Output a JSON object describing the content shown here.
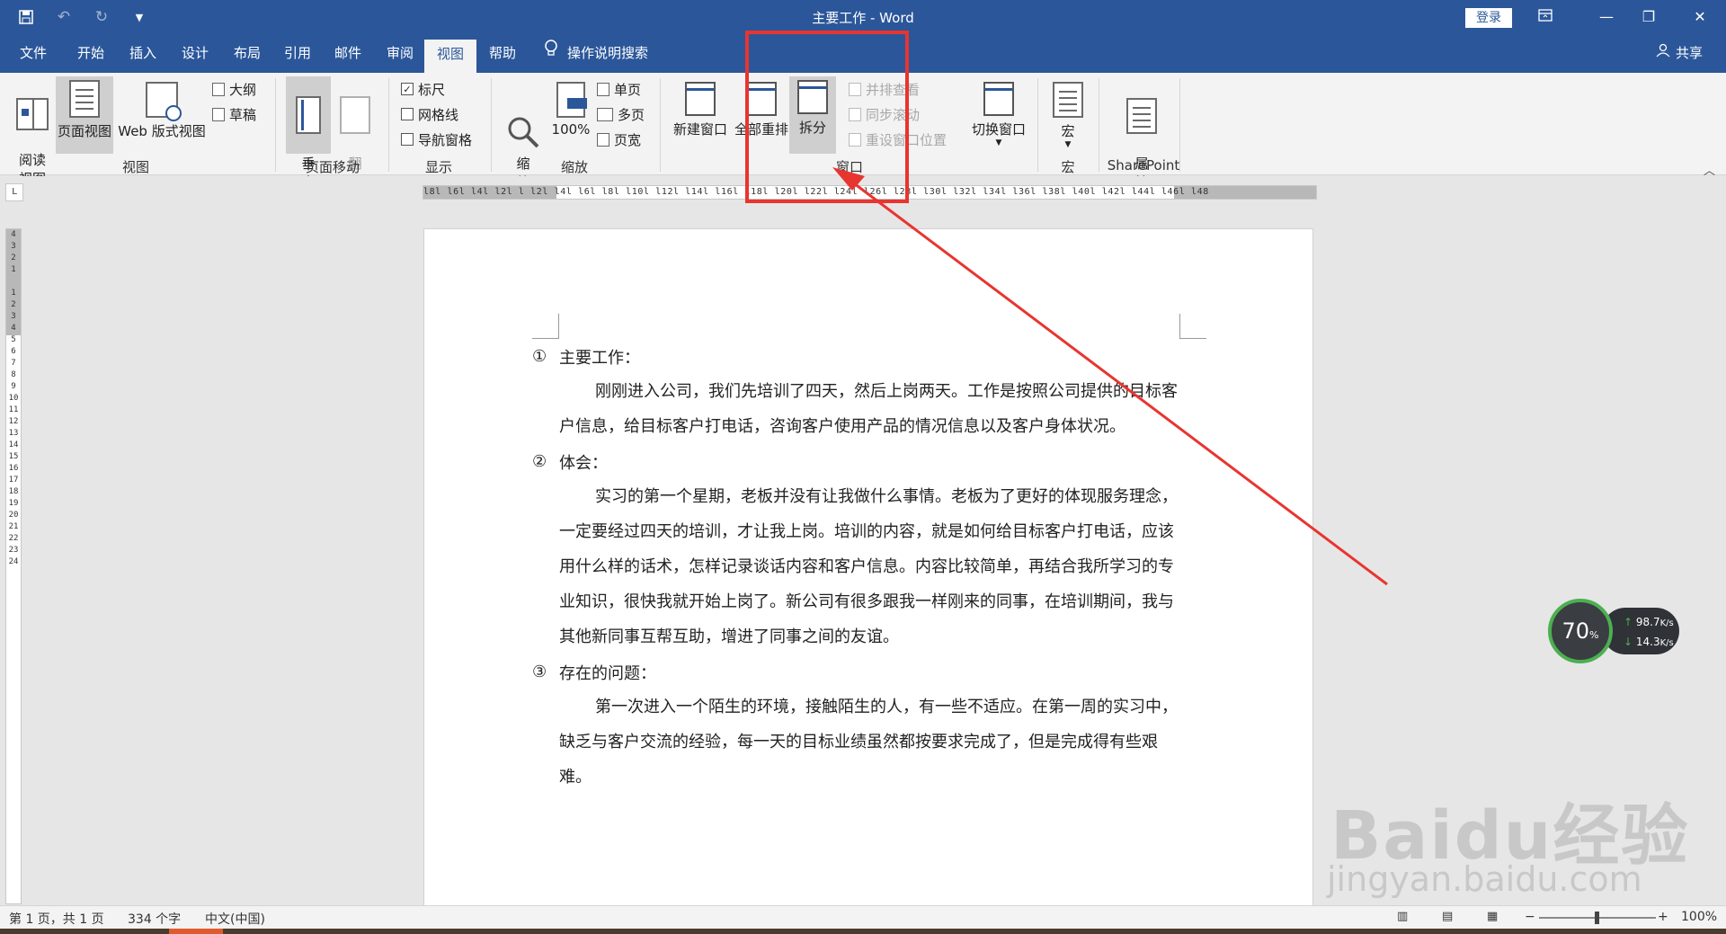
{
  "titlebar": {
    "title": "主要工作  -  Word",
    "login_label": "登录",
    "qat": {
      "save_icon": "save-icon",
      "undo_icon": "undo-icon",
      "redo_icon": "redo-icon",
      "customize_icon": "customize-icon"
    }
  },
  "tabs": [
    "文件",
    "开始",
    "插入",
    "设计",
    "布局",
    "引用",
    "邮件",
    "审阅",
    "视图",
    "帮助"
  ],
  "active_tab": "视图",
  "tell_me": "操作说明搜索",
  "share": "共享",
  "ribbon": {
    "views": {
      "read": "阅读\n视图",
      "print": "页面视图",
      "web": "Web 版式视图",
      "outline": "大纲",
      "draft": "草稿",
      "label": "视图"
    },
    "page_move": {
      "vertical": "垂\n直",
      "side": "翻\n页",
      "label": "页面移动"
    },
    "show": {
      "ruler": "标尺",
      "gridlines": "网格线",
      "nav_pane": "导航窗格",
      "label": "显示",
      "ruler_checked": true
    },
    "zoom": {
      "zoom": "缩\n放",
      "hundred": "100%",
      "one_page": "单页",
      "multi_page": "多页",
      "page_width": "页宽",
      "label": "缩放"
    },
    "window": {
      "new_window": "新建窗口",
      "arrange_all": "全部重排",
      "split": "拆分",
      "side_by_side": "并排查看",
      "sync_scroll": "同步滚动",
      "reset_pos": "重设窗口位置",
      "switch": "切换窗口",
      "label": "窗口"
    },
    "macros": {
      "macros": "宏",
      "label": "宏"
    },
    "sharepoint": {
      "properties": "属\n性",
      "label": "SharePoint"
    }
  },
  "ruler": {
    "h_numbers": "l8l l6l l4l l2l l   l2l l4l l6l l8l l10l l12l l14l l16l l18l l20l l22l l24l l26l l28l l30l l32l l34l l36l l38l l40l l42l l44l l46l l48",
    "v_numbers": "4\n3\n2\n1\n\n1\n2\n3\n4\n5\n6\n7\n8\n9\n10\n11\n12\n13\n14\n15\n16\n17\n18\n19\n20\n21\n22\n23\n24"
  },
  "document": {
    "sections": [
      {
        "num": "①",
        "heading": "主要工作：",
        "body": "刚刚进入公司，我们先培训了四天，然后上岗两天。工作是按照公司提供的目标客户信息，给目标客户打电话，咨询客户使用产品的情况信息以及客户身体状况。"
      },
      {
        "num": "②",
        "heading": "体会：",
        "body": "实习的第一个星期，老板并没有让我做什么事情。老板为了更好的体现服务理念，一定要经过四天的培训，才让我上岗。培训的内容，就是如何给目标客户打电话，应该用什么样的话术，怎样记录谈话内容和客户信息。内容比较简单，再结合我所学习的专业知识，很快我就开始上岗了。新公司有很多跟我一样刚来的同事，在培训期间，我与其他新同事互帮互助，增进了同事之间的友谊。"
      },
      {
        "num": "③",
        "heading": "存在的问题：",
        "body": "第一次进入一个陌生的环境，接触陌生的人，有一些不适应。在第一周的实习中，缺乏与客户交流的经验，每一天的目标业绩虽然都按要求完成了，但是完成得有些艰难。"
      }
    ]
  },
  "statusbar": {
    "page": "第 1 页，共 1 页",
    "words": "334 个字",
    "lang": "中文(中国)",
    "zoom": "100%"
  },
  "speed_widget": {
    "percent": "70",
    "percent_unit": "%",
    "up": "98.7",
    "up_unit": "K/s",
    "down": "14.3",
    "down_unit": "K/s"
  },
  "watermark": {
    "brand": "Baidu经验",
    "url": "jingyan.baidu.com"
  },
  "colors": {
    "accent": "#2b579a",
    "annotation": "#e8352f"
  }
}
